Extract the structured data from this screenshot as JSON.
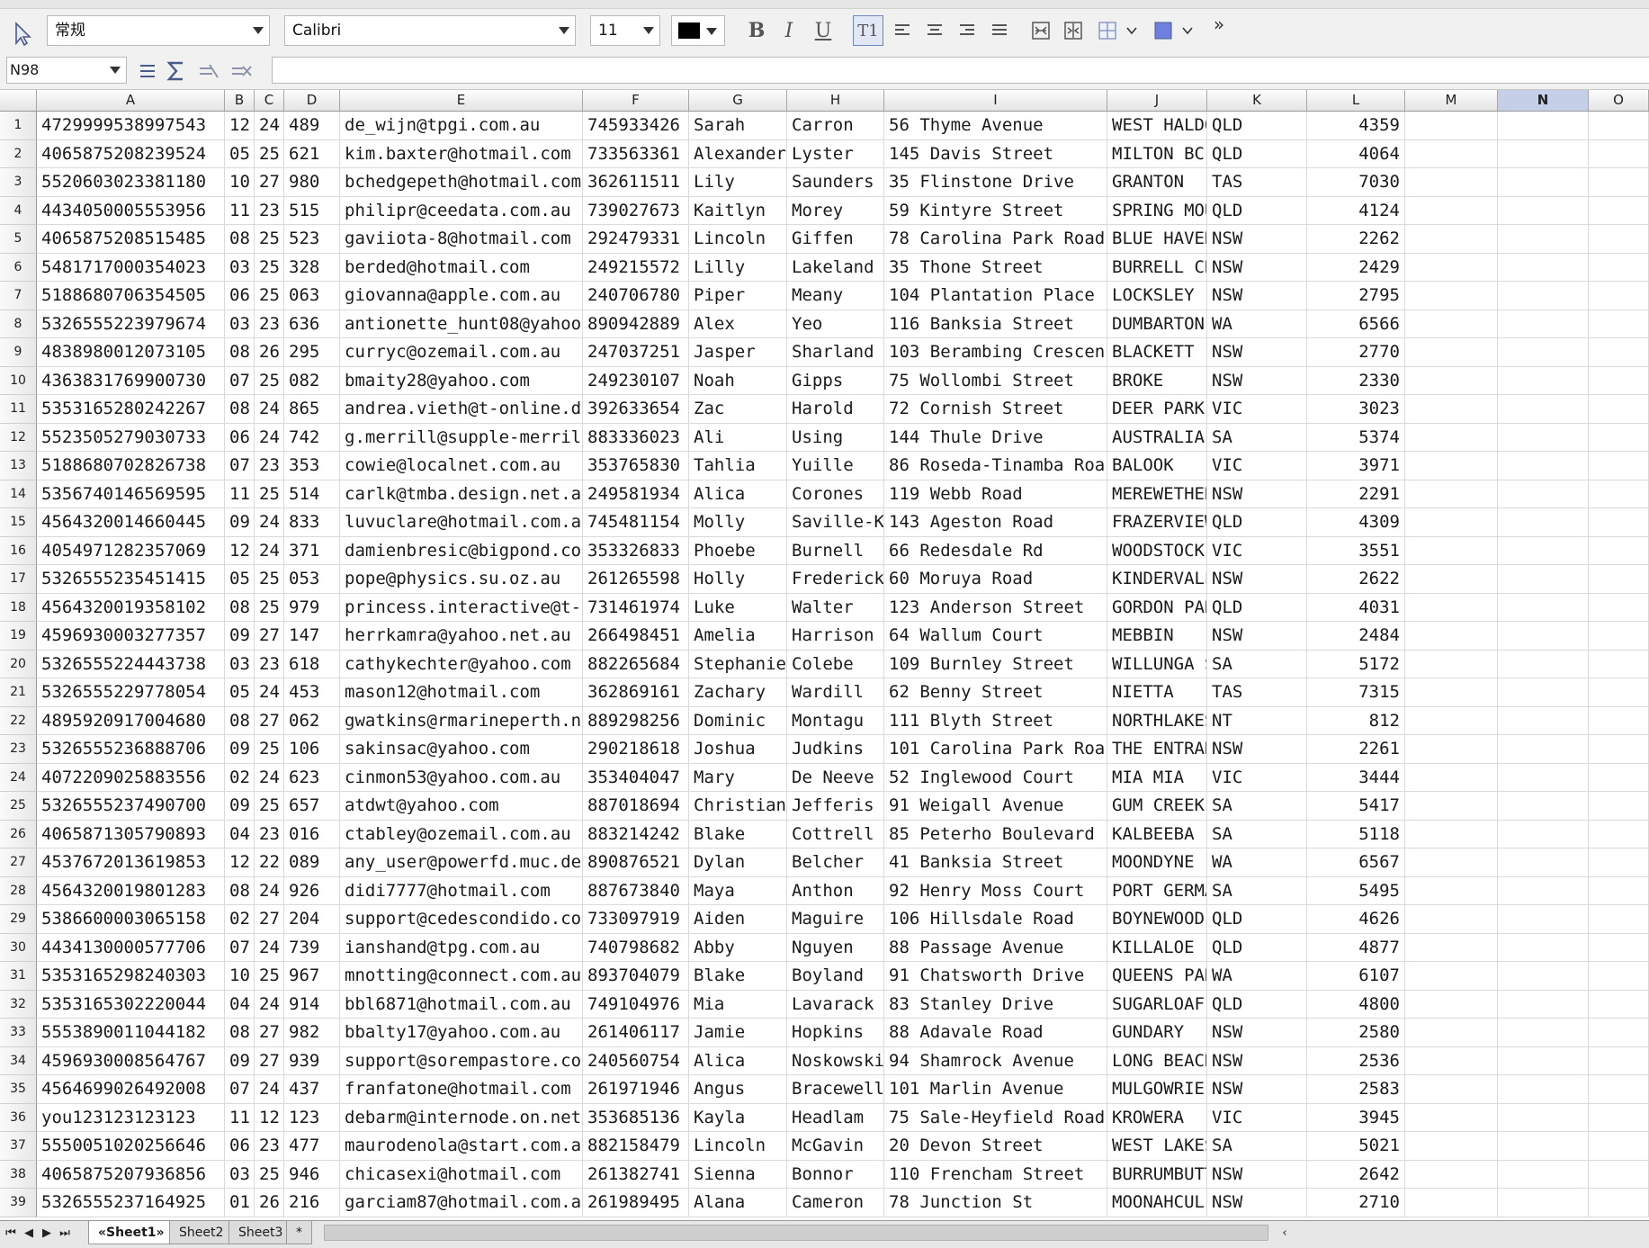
{
  "toolbar": {
    "paragraph_style": "常规",
    "font_name": "Calibri",
    "font_size": "11",
    "font_color": "#000000",
    "overflow_label": "»",
    "buttons": {
      "bold": "B",
      "italic": "I",
      "underline": "U",
      "wrap": "T1"
    }
  },
  "formula_bar": {
    "cell_reference": "N98",
    "formula": ""
  },
  "columns": [
    "A",
    "B",
    "C",
    "D",
    "E",
    "F",
    "G",
    "H",
    "I",
    "J",
    "K",
    "L",
    "M",
    "N",
    "O"
  ],
  "selected_column": "N",
  "rows": [
    [
      "4729999538997543",
      "12",
      "24",
      "489",
      "de_wijn@tpgi.com.au",
      "745933426",
      "Sarah",
      "Carron",
      "56 Thyme Avenue",
      "WEST HALDO",
      "QLD",
      "4359"
    ],
    [
      "4065875208239524",
      "05",
      "25",
      "621",
      "kim.baxter@hotmail.com",
      "733563361",
      "Alexander",
      "Lyster",
      "145 Davis Street",
      "MILTON BC",
      "QLD",
      "4064"
    ],
    [
      "5520603023381180",
      "10",
      "27",
      "980",
      "bchedgepeth@hotmail.com",
      "362611511",
      "Lily",
      "Saunders",
      "35 Flinstone Drive",
      "GRANTON",
      "TAS",
      "7030"
    ],
    [
      "4434050005553956",
      "11",
      "23",
      "515",
      "philipr@ceedata.com.au",
      "739027673",
      "Kaitlyn",
      "Morey",
      "59 Kintyre Street",
      "SPRING MOU",
      "QLD",
      "4124"
    ],
    [
      "4065875208515485",
      "08",
      "25",
      "523",
      "gaviiota-8@hotmail.com",
      "292479331",
      "Lincoln",
      "Giffen",
      "78 Carolina Park Road",
      "BLUE HAVEN",
      "NSW",
      "2262"
    ],
    [
      "5481717000354023",
      "03",
      "25",
      "328",
      "berded@hotmail.com",
      "249215572",
      "Lilly",
      "Lakeland",
      "35 Thone Street",
      "BURRELL CR",
      "NSW",
      "2429"
    ],
    [
      "5188680706354505",
      "06",
      "25",
      "063",
      "giovanna@apple.com.au",
      "240706780",
      "Piper",
      "Meany",
      "104 Plantation Place",
      "LOCKSLEY",
      "NSW",
      "2795"
    ],
    [
      "5326555223979674",
      "03",
      "23",
      "636",
      "antionette_hunt08@yahoo.",
      "890942889",
      "Alex",
      "Yeo",
      "116 Banksia Street",
      "DUMBARTON",
      "WA",
      "6566"
    ],
    [
      "4838980012073105",
      "08",
      "26",
      "295",
      "curryc@ozemail.com.au",
      "247037251",
      "Jasper",
      "Sharland",
      "103 Berambing Crescen",
      "BLACKETT",
      "NSW",
      "2770"
    ],
    [
      "4363831769900730",
      "07",
      "25",
      "082",
      "bmaity28@yahoo.com",
      "249230107",
      "Noah",
      "Gipps",
      "75 Wollombi Street",
      "BROKE",
      "NSW",
      "2330"
    ],
    [
      "5353165280242267",
      "08",
      "24",
      "865",
      "andrea.vieth@t-online.de",
      "392633654",
      "Zac",
      "Harold",
      "72 Cornish Street",
      "DEER PARK",
      "VIC",
      "3023"
    ],
    [
      "5523505279030733",
      "06",
      "24",
      "742",
      "g.merrill@supple-merrill",
      "883336023",
      "Ali",
      "Using",
      "144 Thule Drive",
      "AUSTRALIA",
      "SA",
      "5374"
    ],
    [
      "5188680702826738",
      "07",
      "23",
      "353",
      "cowie@localnet.com.au",
      "353765830",
      "Tahlia",
      "Yuille",
      "86 Roseda-Tinamba Roa",
      "BALOOK",
      "VIC",
      "3971"
    ],
    [
      "5356740146569595",
      "11",
      "25",
      "514",
      "carlk@tmba.design.net.au",
      "249581934",
      "Alica",
      "Corones",
      "119 Webb Road",
      "MEREWETHER",
      "NSW",
      "2291"
    ],
    [
      "4564320014660445",
      "09",
      "24",
      "833",
      "luvuclare@hotmail.com.au",
      "745481154",
      "Molly",
      "Saville-Ke",
      "143 Ageston Road",
      "FRAZERVIEW",
      "QLD",
      "4309"
    ],
    [
      "4054971282357069",
      "12",
      "24",
      "371",
      "damienbresic@bigpond.com",
      "353326833",
      "Phoebe",
      "Burnell",
      "66 Redesdale Rd",
      "WOODSTOCK",
      "VIC",
      "3551"
    ],
    [
      "5326555235451415",
      "05",
      "25",
      "053",
      "pope@physics.su.oz.au",
      "261265598",
      "Holly",
      "Frederick",
      "60 Moruya Road",
      "KINDERVALE",
      "NSW",
      "2622"
    ],
    [
      "4564320019358102",
      "08",
      "25",
      "979",
      "princess.interactive@t-o",
      "731461974",
      "Luke",
      "Walter",
      "123 Anderson Street",
      "GORDON PAR",
      "QLD",
      "4031"
    ],
    [
      "4596930003277357",
      "09",
      "27",
      "147",
      "herrkamra@yahoo.net.au",
      "266498451",
      "Amelia",
      "Harrison",
      "64 Wallum Court",
      "MEBBIN",
      "NSW",
      "2484"
    ],
    [
      "5326555224443738",
      "03",
      "23",
      "618",
      "cathykechter@yahoo.com",
      "882265684",
      "Stephanie",
      "Colebe",
      "109 Burnley Street",
      "WILLUNGA S",
      "SA",
      "5172"
    ],
    [
      "5326555229778054",
      "05",
      "24",
      "453",
      "mason12@hotmail.com",
      "362869161",
      "Zachary",
      "Wardill",
      "62 Benny Street",
      "NIETTA",
      "TAS",
      "7315"
    ],
    [
      "4895920917004680",
      "08",
      "27",
      "062",
      "gwatkins@rmarineperth.ne",
      "889298256",
      "Dominic",
      "Montagu",
      "111 Blyth Street",
      "NORTHLAKES",
      "NT",
      "812"
    ],
    [
      "5326555236888706",
      "09",
      "25",
      "106",
      "sakinsac@yahoo.com",
      "290218618",
      "Joshua",
      "Judkins",
      "101 Carolina Park Roa",
      "THE ENTRAN",
      "NSW",
      "2261"
    ],
    [
      "4072209025883556",
      "02",
      "24",
      "623",
      "cinmon53@yahoo.com.au",
      "353404047",
      "Mary",
      "De Neeve",
      "52 Inglewood Court",
      "MIA MIA",
      "VIC",
      "3444"
    ],
    [
      "5326555237490700",
      "09",
      "25",
      "657",
      "atdwt@yahoo.com",
      "887018694",
      "Christian",
      "Jefferis",
      "91 Weigall Avenue",
      "GUM CREEK",
      "SA",
      "5417"
    ],
    [
      "4065871305790893",
      "04",
      "23",
      "016",
      "ctabley@ozemail.com.au",
      "883214242",
      "Blake",
      "Cottrell",
      "85 Peterho Boulevard",
      "KALBEEBA",
      "SA",
      "5118"
    ],
    [
      "4537672013619853",
      "12",
      "22",
      "089",
      "any_user@powerfd.muc.de",
      "890876521",
      "Dylan",
      "Belcher",
      "41 Banksia Street",
      "MOONDYNE",
      "WA",
      "6567"
    ],
    [
      "4564320019801283",
      "08",
      "24",
      "926",
      "didi7777@hotmail.com",
      "887673840",
      "Maya",
      "Anthon",
      "92 Henry Moss Court",
      "PORT GERMA",
      "SA",
      "5495"
    ],
    [
      "5386600003065158",
      "02",
      "27",
      "204",
      "support@cedescondido.com",
      "733097919",
      "Aiden",
      "Maguire",
      "106 Hillsdale Road",
      "BOYNEWOOD",
      "QLD",
      "4626"
    ],
    [
      "4434130000577706",
      "07",
      "24",
      "739",
      "ianshand@tpg.com.au",
      "740798682",
      "Abby",
      "Nguyen",
      "88 Passage Avenue",
      "KILLALOE",
      "QLD",
      "4877"
    ],
    [
      "5353165298240303",
      "10",
      "25",
      "967",
      "mnotting@connect.com.au",
      "893704079",
      "Blake",
      "Boyland",
      "91 Chatsworth Drive",
      "QUEENS PAR",
      "WA",
      "6107"
    ],
    [
      "5353165302220044",
      "04",
      "24",
      "914",
      "bbl6871@hotmail.com.au",
      "749104976",
      "Mia",
      "Lavarack",
      "83 Stanley Drive",
      "SUGARLOAF",
      "QLD",
      "4800"
    ],
    [
      "5553890011044182",
      "08",
      "27",
      "982",
      "bbalty17@yahoo.com.au",
      "261406117",
      "Jamie",
      "Hopkins",
      "88 Adavale Road",
      "GUNDARY",
      "NSW",
      "2580"
    ],
    [
      "4596930008564767",
      "09",
      "27",
      "939",
      "support@sorempastore.com",
      "240560754",
      "Alica",
      "Noskowski",
      "94 Shamrock Avenue",
      "LONG BEACH",
      "NSW",
      "2536"
    ],
    [
      "4564699026492008",
      "07",
      "24",
      "437",
      "franfatone@hotmail.com",
      "261971946",
      "Angus",
      "Bracewell",
      "101 Marlin Avenue",
      "MULGOWRIE",
      "NSW",
      "2583"
    ],
    [
      "you123123123123",
      "11",
      "12",
      "123",
      "debarm@internode.on.net",
      "353685136",
      "Kayla",
      "Headlam",
      "75 Sale-Heyfield Road",
      "KROWERA",
      "VIC",
      "3945"
    ],
    [
      "5550051020256646",
      "06",
      "23",
      "477",
      "maurodenola@start.com.au",
      "882158479",
      "Lincoln",
      "McGavin",
      "20 Devon Street",
      "WEST LAKES",
      "SA",
      "5021"
    ],
    [
      "4065875207936856",
      "03",
      "25",
      "946",
      "chicasexi@hotmail.com",
      "261382741",
      "Sienna",
      "Bonnor",
      "110 Frencham Street",
      "BURRUMBUTT",
      "NSW",
      "2642"
    ],
    [
      "5326555237164925",
      "01",
      "26",
      "216",
      "garciam87@hotmail.com.au",
      "261989495",
      "Alana",
      "Cameron",
      "78 Junction St",
      "MOONAHCULL",
      "NSW",
      "2710"
    ]
  ],
  "sheet_tabs": {
    "tabs": [
      "«Sheet1»",
      "Sheet2",
      "Sheet3",
      "*"
    ],
    "active": 0
  }
}
